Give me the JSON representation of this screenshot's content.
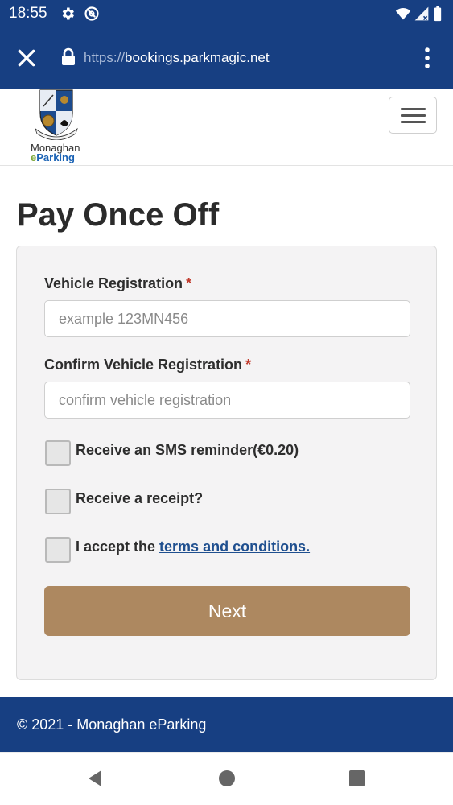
{
  "status_bar": {
    "time": "18:55",
    "icons": [
      "gear-icon",
      "vpn-icon",
      "wifi-icon",
      "signal-icon",
      "battery-icon"
    ]
  },
  "browser": {
    "url_scheme": "https://",
    "url_host": "bookings.parkmagic.net",
    "icons": [
      "close-icon",
      "lock-icon",
      "more-vert-icon"
    ]
  },
  "brand": {
    "line1": "Monaghan",
    "line2_prefix": "e",
    "line2_rest": "Parking"
  },
  "page": {
    "title": "Pay Once Off"
  },
  "form": {
    "vehicle_reg_label": "Vehicle Registration",
    "vehicle_reg_placeholder": "example 123MN456",
    "vehicle_reg_value": "",
    "confirm_reg_label": "Confirm Vehicle Registration",
    "confirm_reg_placeholder": "confirm vehicle registration",
    "confirm_reg_value": "",
    "required_mark": "*",
    "sms_label": "Receive an SMS reminder(€0.20)",
    "sms_checked": false,
    "receipt_label": "Receive a receipt?",
    "receipt_checked": false,
    "terms_prefix": "I accept the ",
    "terms_link": "terms and conditions.",
    "terms_checked": false,
    "next_label": "Next"
  },
  "footer": {
    "copyright": "© 2021 - Monaghan eParking"
  },
  "colors": {
    "header_bg": "#173f82",
    "button_bg": "#ad8860",
    "required": "#c0392b",
    "link": "#1f4f8f"
  },
  "system_nav": [
    "back-icon",
    "home-icon",
    "recents-icon"
  ]
}
